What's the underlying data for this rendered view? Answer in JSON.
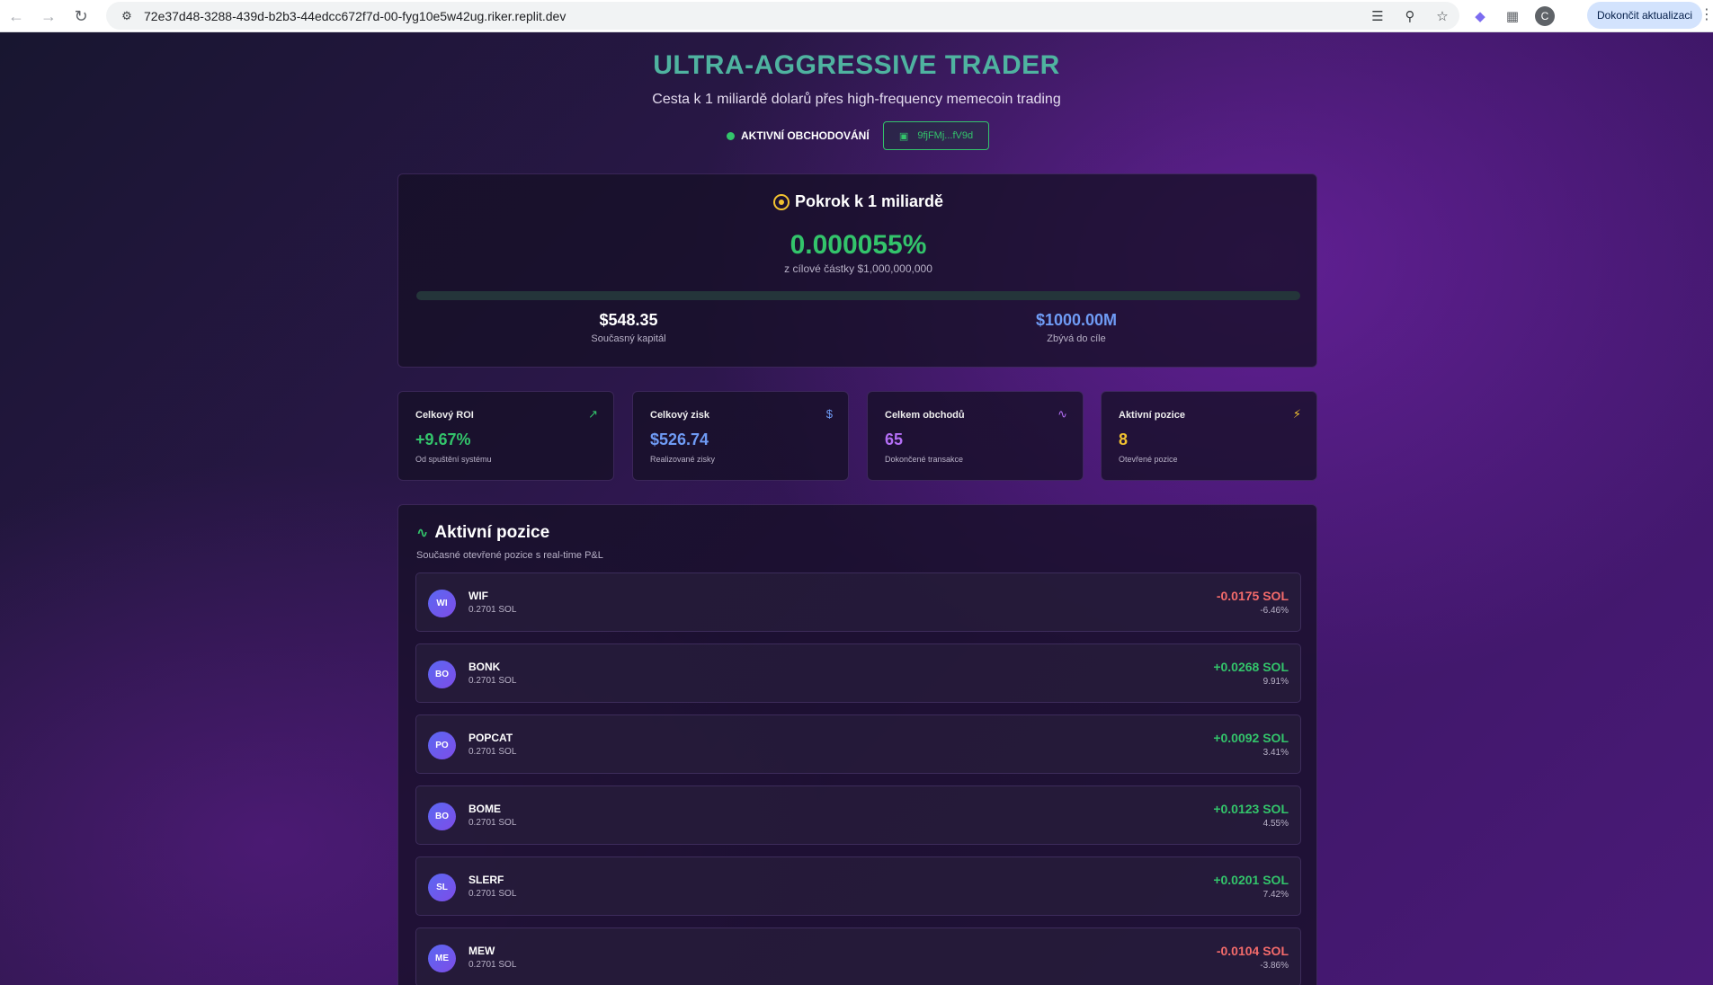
{
  "browser": {
    "url": "72e37d48-3288-439d-b2b3-44edcc672f7d-00-fyg10e5w42ug.riker.replit.dev",
    "avatar_letter": "C",
    "update_label": "Dokončit aktualizaci"
  },
  "header": {
    "title": "ULTRA-AGGRESSIVE TRADER",
    "subtitle": "Cesta k 1 miliardě dolarů přes high-frequency memecoin trading",
    "status": "AKTIVNÍ OBCHODOVÁNÍ",
    "wallet": "9fjFMj...fV9d"
  },
  "progress": {
    "title": "Pokrok k 1 miliardě",
    "percent": "0.000055%",
    "subtitle": "z cílové částky $1,000,000,000",
    "fill_fraction": 5.5e-07,
    "capital_value": "$548.35",
    "capital_label": "Současný kapitál",
    "remaining_value": "$1000.00M",
    "remaining_label": "Zbývá do cíle"
  },
  "stats": [
    {
      "title": "Celkový ROI",
      "value": "+9.67%",
      "sub": "Od spuštění systému",
      "icon": "trending-up-icon",
      "color": "#33c46b"
    },
    {
      "title": "Celkový zisk",
      "value": "$526.74",
      "sub": "Realizované zisky",
      "icon": "dollar-icon",
      "color": "#6f9bf5"
    },
    {
      "title": "Celkem obchodů",
      "value": "65",
      "sub": "Dokončené transakce",
      "icon": "activity-icon",
      "color": "#b36ef5"
    },
    {
      "title": "Aktivní pozice",
      "value": "8",
      "sub": "Otevřené pozice",
      "icon": "zap-icon",
      "color": "#f2c230"
    }
  ],
  "positions": {
    "title": "Aktivní pozice",
    "subtitle": "Současné otevřené pozice s real-time P&L",
    "items": [
      {
        "initials": "WI",
        "symbol": "WIF",
        "amount": "0.2701 SOL",
        "pnl": "-0.0175 SOL",
        "pct": "-6.46%",
        "dir": "neg"
      },
      {
        "initials": "BO",
        "symbol": "BONK",
        "amount": "0.2701 SOL",
        "pnl": "+0.0268 SOL",
        "pct": "9.91%",
        "dir": "pos"
      },
      {
        "initials": "PO",
        "symbol": "POPCAT",
        "amount": "0.2701 SOL",
        "pnl": "+0.0092 SOL",
        "pct": "3.41%",
        "dir": "pos"
      },
      {
        "initials": "BO",
        "symbol": "BOME",
        "amount": "0.2701 SOL",
        "pnl": "+0.0123 SOL",
        "pct": "4.55%",
        "dir": "pos"
      },
      {
        "initials": "SL",
        "symbol": "SLERF",
        "amount": "0.2701 SOL",
        "pnl": "+0.0201 SOL",
        "pct": "7.42%",
        "dir": "pos"
      },
      {
        "initials": "ME",
        "symbol": "MEW",
        "amount": "0.2701 SOL",
        "pnl": "-0.0104 SOL",
        "pct": "-3.86%",
        "dir": "neg"
      }
    ]
  }
}
